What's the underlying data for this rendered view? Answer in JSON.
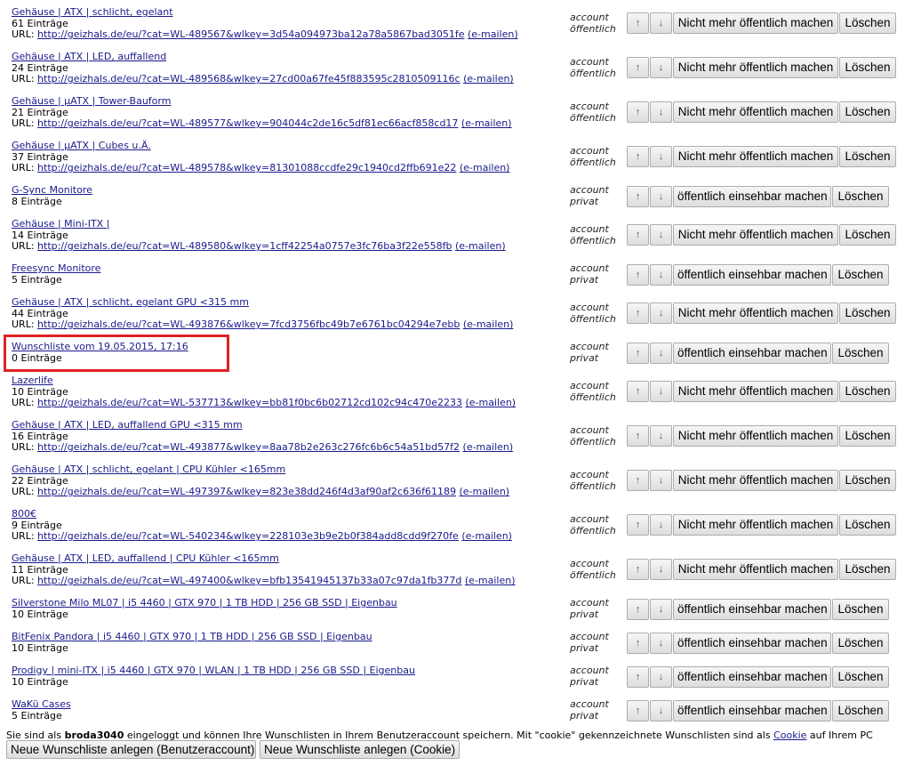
{
  "labels": {
    "account": "account",
    "url_prefix": "URL: ",
    "email": "(e-mailen)",
    "up_arrow": "↑",
    "down_arrow": "↓",
    "delete": "Löschen"
  },
  "rows": [
    {
      "title": "Gehäuse | ATX | schlicht, egelant",
      "count": "61 Einträge",
      "url": "http://geizhals.de/eu/?cat=WL-489567&wlkey=3d54a094973ba12a78a5867bad3051fe",
      "visibility": "öffentlich",
      "toggle": "Nicht mehr öffentlich machen"
    },
    {
      "title": "Gehäuse | ATX | LED, auffallend",
      "count": "24 Einträge",
      "url": "http://geizhals.de/eu/?cat=WL-489568&wlkey=27cd00a67fe45f883595c2810509116c",
      "visibility": "öffentlich",
      "toggle": "Nicht mehr öffentlich machen"
    },
    {
      "title": "Gehäuse | µATX | Tower-Bauform ",
      "count": "21 Einträge",
      "url": "http://geizhals.de/eu/?cat=WL-489577&wlkey=904044c2de16c5df81ec66acf858cd17",
      "visibility": "öffentlich",
      "toggle": "Nicht mehr öffentlich machen"
    },
    {
      "title": "Gehäuse | µATX | Cubes u.Ä.",
      "count": "37 Einträge",
      "url": "http://geizhals.de/eu/?cat=WL-489578&wlkey=81301088ccdfe29c1940cd2ffb691e22",
      "visibility": "öffentlich",
      "toggle": "Nicht mehr öffentlich machen"
    },
    {
      "title": "G-Sync Monitore",
      "count": "8 Einträge",
      "url": "",
      "visibility": "privat",
      "toggle": "öffentlich einsehbar machen"
    },
    {
      "title": "Gehäuse | Mini-ITX | ",
      "count": "14 Einträge",
      "url": "http://geizhals.de/eu/?cat=WL-489580&wlkey=1cff42254a0757e3fc76ba3f22e558fb",
      "visibility": "öffentlich",
      "toggle": "Nicht mehr öffentlich machen"
    },
    {
      "title": "Freesync Monitore",
      "count": "5 Einträge",
      "url": "",
      "visibility": "privat",
      "toggle": "öffentlich einsehbar machen"
    },
    {
      "title": "Gehäuse | ATX | schlicht, egelant GPU <315 mm",
      "count": "44 Einträge",
      "url": "http://geizhals.de/eu/?cat=WL-493876&wlkey=7fcd3756fbc49b7e6761bc04294e7ebb",
      "visibility": "öffentlich",
      "toggle": "Nicht mehr öffentlich machen"
    },
    {
      "title": "Wunschliste vom 19.05.2015, 17:16",
      "count": "0 Einträge",
      "url": "",
      "visibility": "privat",
      "toggle": "öffentlich einsehbar machen"
    },
    {
      "title": "Lazerlife",
      "count": "10 Einträge",
      "url": "http://geizhals.de/eu/?cat=WL-537713&wlkey=bb81f0bc6b02712cd102c94c470e2233",
      "visibility": "öffentlich",
      "toggle": "Nicht mehr öffentlich machen"
    },
    {
      "title": "Gehäuse | ATX | LED, auffallend GPU <315 mm",
      "count": "16 Einträge",
      "url": "http://geizhals.de/eu/?cat=WL-493877&wlkey=8aa78b2e263c276fc6b6c54a51bd57f2",
      "visibility": "öffentlich",
      "toggle": "Nicht mehr öffentlich machen"
    },
    {
      "title": "Gehäuse | ATX | schlicht, egelant | CPU Kühler <165mm",
      "count": "22 Einträge",
      "url": "http://geizhals.de/eu/?cat=WL-497397&wlkey=823e38dd246f4d3af90af2c636f61189",
      "visibility": "öffentlich",
      "toggle": "Nicht mehr öffentlich machen"
    },
    {
      "title": "800€",
      "count": "9 Einträge",
      "url": "http://geizhals.de/eu/?cat=WL-540234&wlkey=228103e3b9e2b0f384add8cdd9f270fe",
      "visibility": "öffentlich",
      "toggle": "Nicht mehr öffentlich machen"
    },
    {
      "title": "Gehäuse | ATX | LED, auffallend | CPU Kühler <165mm",
      "count": "11 Einträge",
      "url": "http://geizhals.de/eu/?cat=WL-497400&wlkey=bfb13541945137b33a07c97da1fb377d",
      "visibility": "öffentlich",
      "toggle": "Nicht mehr öffentlich machen"
    },
    {
      "title": "Silverstone Milo ML07 | i5 4460 | GTX 970 | 1 TB HDD | 256 GB SSD | Eigenbau",
      "count": "10 Einträge",
      "url": "",
      "visibility": "privat",
      "toggle": "öffentlich einsehbar machen"
    },
    {
      "title": "BitFenix Pandora | i5 4460 | GTX 970 | 1 TB HDD | 256 GB SSD | Eigenbau",
      "count": "10 Einträge",
      "url": "",
      "visibility": "privat",
      "toggle": "öffentlich einsehbar machen"
    },
    {
      "title": "Prodigy | mini-ITX | i5 4460 | GTX 970 | WLAN | 1 TB HDD | 256 GB SSD | Eigenbau",
      "count": "10 Einträge",
      "url": "",
      "visibility": "privat",
      "toggle": "öffentlich einsehbar machen"
    },
    {
      "title": "WaKü Cases",
      "count": "5 Einträge",
      "url": "",
      "visibility": "privat",
      "toggle": "öffentlich einsehbar machen"
    }
  ],
  "footer": {
    "text_before_user": "Sie sind als ",
    "username": "broda3040",
    "text_after_user": " eingeloggt und können Ihre Wunschlisten in Ihrem Benutzeraccount speichern. Mit \"cookie\" gekennzeichnete Wunschlisten sind als ",
    "cookie_link": "Cookie",
    "text_end": " auf Ihrem PC",
    "new_account_button": "Neue Wunschliste anlegen (Benutzeraccount)",
    "new_cookie_button": "Neue Wunschliste anlegen (Cookie)"
  },
  "highlight_row": 8
}
